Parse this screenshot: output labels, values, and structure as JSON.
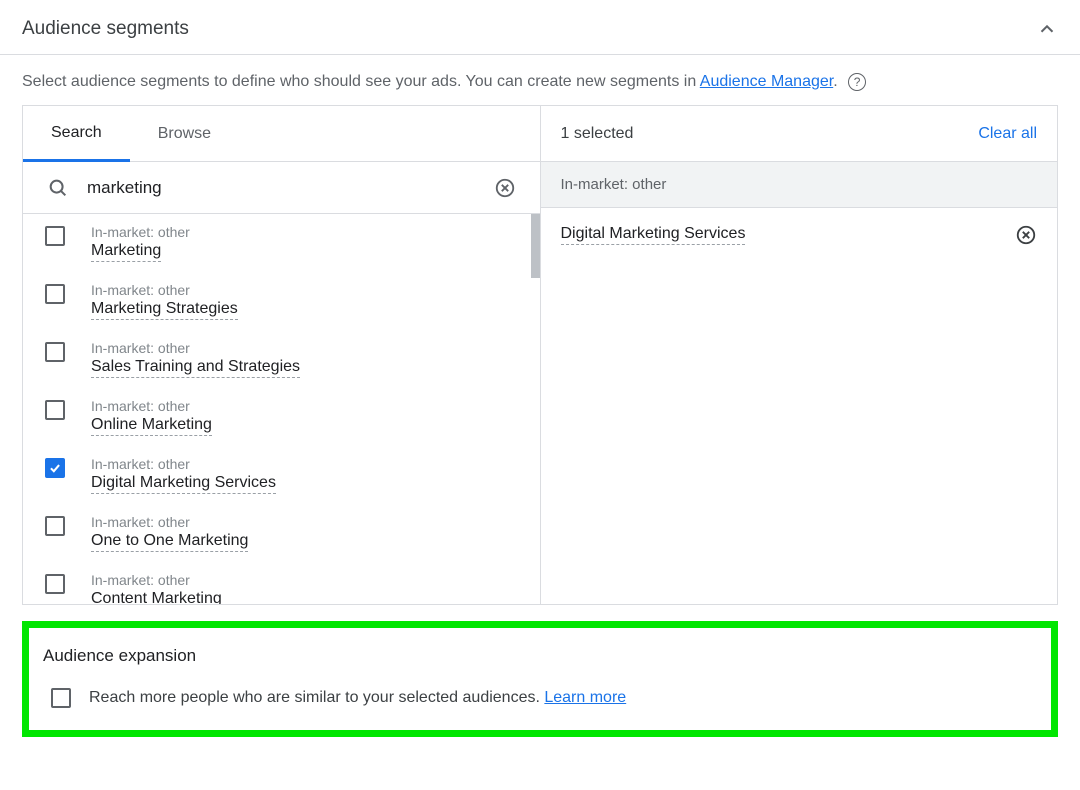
{
  "header": {
    "title": "Audience segments"
  },
  "description": {
    "pre": "Select audience segments to define who should see your ads. You can create new segments in ",
    "link": "Audience Manager",
    "post": "."
  },
  "tabs": {
    "search": "Search",
    "browse": "Browse"
  },
  "search": {
    "value": "marketing"
  },
  "results": [
    {
      "category": "In-market: other",
      "name": "Marketing",
      "checked": false
    },
    {
      "category": "In-market: other",
      "name": "Marketing Strategies",
      "checked": false
    },
    {
      "category": "In-market: other",
      "name": "Sales Training and Strategies",
      "checked": false
    },
    {
      "category": "In-market: other",
      "name": "Online Marketing",
      "checked": false
    },
    {
      "category": "In-market: other",
      "name": "Digital Marketing Services",
      "checked": true
    },
    {
      "category": "In-market: other",
      "name": "One to One Marketing",
      "checked": false
    },
    {
      "category": "In-market: other",
      "name": "Content Marketing",
      "checked": false
    }
  ],
  "rightPanel": {
    "count": "1 selected",
    "clear": "Clear all",
    "groupHeader": "In-market: other",
    "selected": [
      {
        "name": "Digital Marketing Services"
      }
    ]
  },
  "expansion": {
    "title": "Audience expansion",
    "text": "Reach more people who are similar to your selected audiences. ",
    "learn": "Learn more"
  }
}
